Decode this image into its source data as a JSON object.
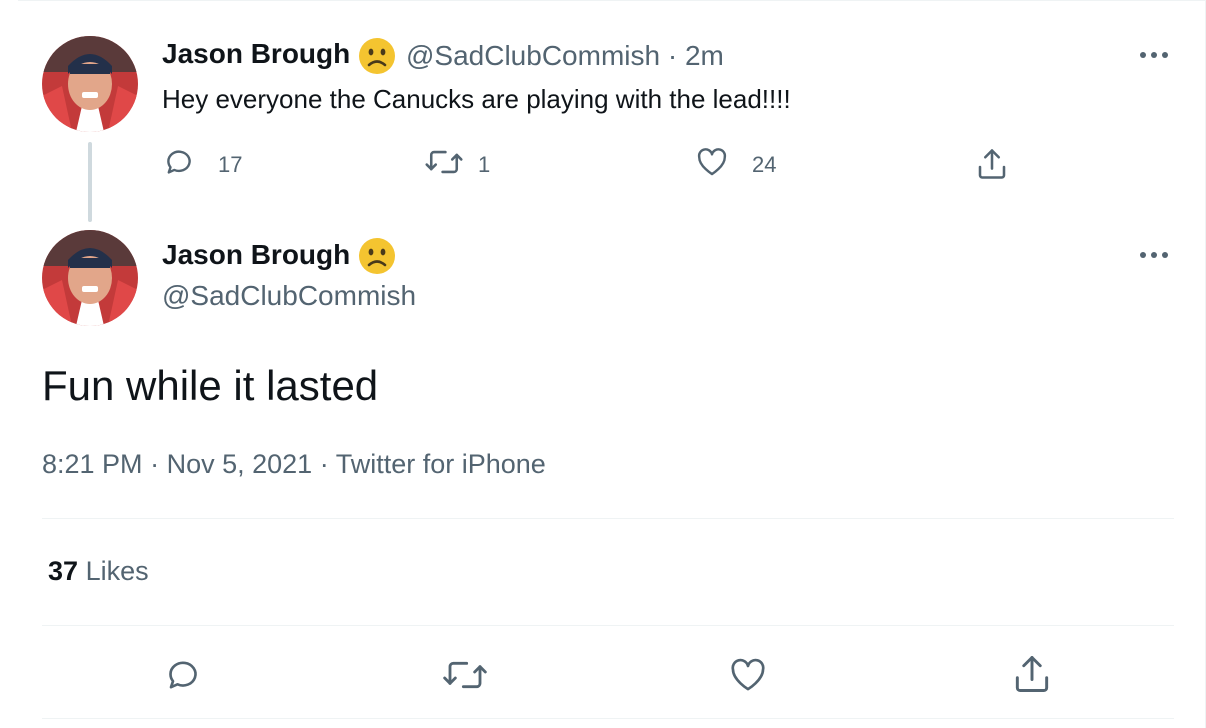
{
  "tweet1": {
    "name": "Jason Brough",
    "handle": "@SadClubCommish",
    "separator": "·",
    "time": "2m",
    "text": "Hey everyone the Canucks are playing with the lead!!!!",
    "replies": "17",
    "retweets": "1",
    "likes": "24"
  },
  "tweet2": {
    "name": "Jason Brough",
    "handle": "@SadClubCommish",
    "text": "Fun while it lasted",
    "meta": {
      "time": "8:21 PM",
      "sep1": "·",
      "date": "Nov 5, 2021",
      "sep2": "·",
      "source": "Twitter for iPhone"
    },
    "likes_count": "37",
    "likes_label": "Likes"
  },
  "icons": {
    "name_emoji": "slightly-frowning-face",
    "more": "more-horizontal",
    "reply": "reply-icon",
    "retweet": "retweet-icon",
    "like": "heart-icon",
    "share": "share-icon"
  },
  "colors": {
    "text": "#0f1419",
    "secondary": "#536471",
    "emoji": "#f4c430",
    "thread_line": "#cfd9de",
    "border": "#eff3f4"
  }
}
